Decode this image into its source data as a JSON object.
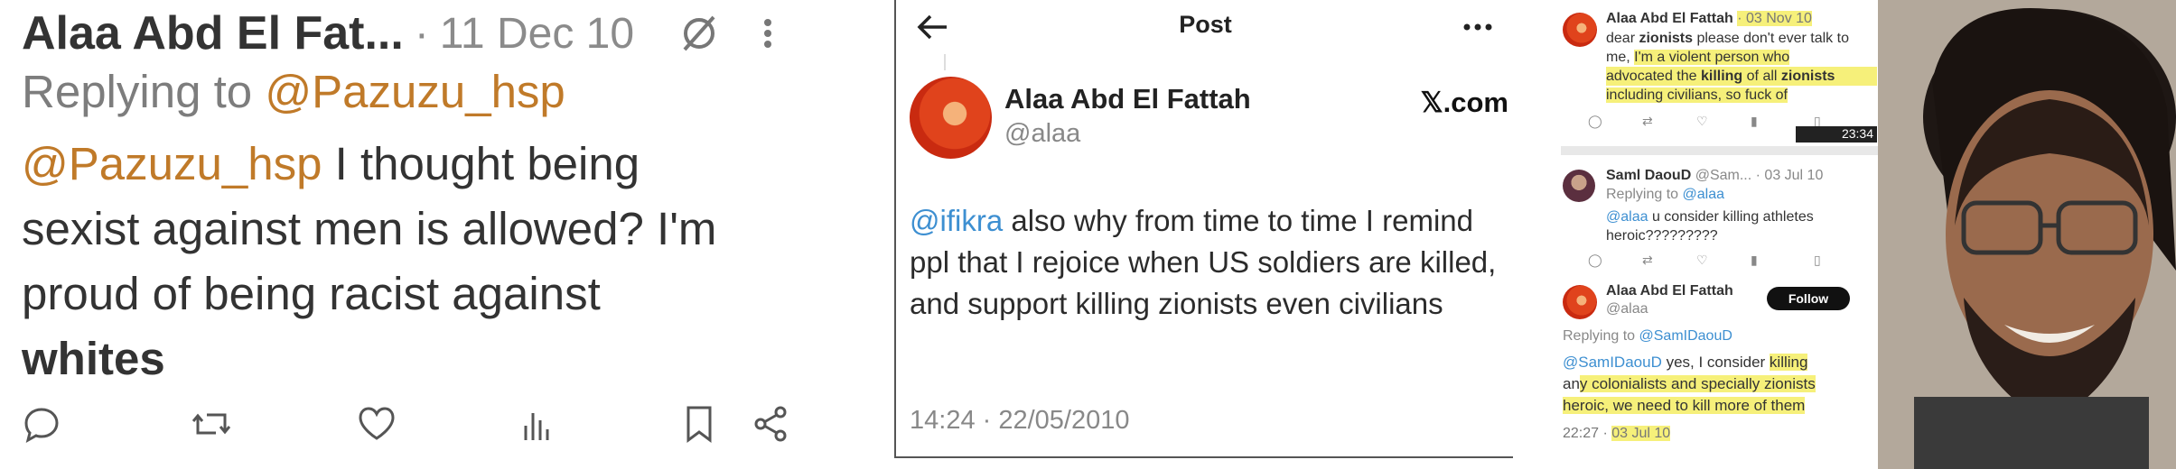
{
  "panel1": {
    "author_name": "Alaa Abd El Fat...",
    "separator": "·",
    "date": "11 Dec 10",
    "reply_prefix": "Replying to",
    "reply_handle": "@Pazuzu_hsp",
    "body_mention": "@Pazuzu_hsp",
    "body_line1_rest": " I thought being",
    "body_line2": "sexist against men is allowed? I'm",
    "body_line3": "proud of being racist against",
    "body_line4_bold": "whites",
    "icons": [
      "reply-icon",
      "retweet-icon",
      "like-icon",
      "views-icon",
      "bookmark-icon",
      "share-icon"
    ]
  },
  "panel2": {
    "title": "Post",
    "author_name": "Alaa Abd El Fattah",
    "author_handle": "@alaa",
    "brand": "𝕏.com",
    "body_mention": "@ifikra",
    "body_text": " also why from time to time I remind ppl that I rejoice when US soldiers are killed, and support killing zionists even civilians",
    "timestamp": "14:24 · 22/05/2010"
  },
  "panel3": {
    "tweet1": {
      "name": "Alaa Abd El Fattah",
      "date": "· 03 Nov 10",
      "line1_pre": "dear ",
      "line1_bold": "zionists",
      "line1_post": " please don't ever talk to",
      "line2_pre": "me, ",
      "line2_hl": "I'm a violent person who",
      "line3_pre": "advocated the ",
      "line3_bold": "killing",
      "line3_mid": " of all ",
      "line3_bold2": "zionists",
      "line4": "including civilians, so fuck of",
      "video_time": "23:34"
    },
    "tweet2": {
      "name": "Saml DaouD",
      "handle": "@Sam...",
      "date": "· 03 Jul 10",
      "reply_prefix": "Replying to ",
      "reply_handle": "@alaa",
      "body_mention": "@alaa",
      "body_text": " u consider killing athletes",
      "body_line2": "heroic?????????"
    },
    "tweet3": {
      "name": "Alaa Abd El Fattah",
      "handle": "@alaa",
      "follow_label": "Follow",
      "reply_prefix": "Replying to ",
      "reply_handle": "@SamIDaouD",
      "body_mention": "@SamIDaouD",
      "body_line1_pre": " yes, I consider ",
      "body_line1_hl": "killing",
      "body_line2_pre": "an",
      "body_line2_hl": "y colonialists and specially zionists",
      "body_line3_hl": "heroic, we need to kill more of them",
      "time": "22:27 · ",
      "date_hl": "03 Jul 10"
    },
    "highlight_color": "#f6f07a"
  }
}
